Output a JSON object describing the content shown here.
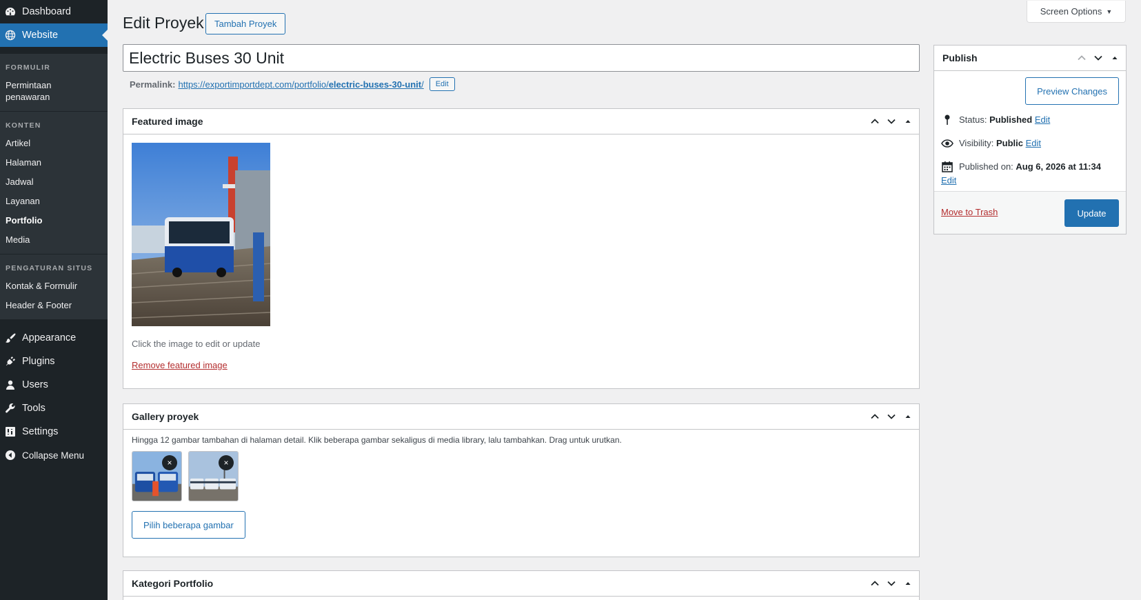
{
  "sidebar": {
    "top_items": [
      {
        "label": "Dashboard",
        "icon": "dashboard-icon"
      },
      {
        "label": "Website",
        "icon": "globe-icon",
        "active": true
      }
    ],
    "sections": [
      {
        "heading": "FORMULIR",
        "items": [
          "Permintaan penawaran"
        ]
      },
      {
        "heading": "KONTEN",
        "items": [
          "Artikel",
          "Halaman",
          "Jadwal",
          "Layanan",
          "Portfolio",
          "Media"
        ],
        "current": "Portfolio"
      },
      {
        "heading": "PENGATURAN SITUS",
        "items": [
          "Kontak & Formulir",
          "Header & Footer"
        ]
      }
    ],
    "lower_items": [
      {
        "label": "Appearance",
        "icon": "paintbrush-icon"
      },
      {
        "label": "Plugins",
        "icon": "plug-icon"
      },
      {
        "label": "Users",
        "icon": "user-icon"
      },
      {
        "label": "Tools",
        "icon": "wrench-icon"
      },
      {
        "label": "Settings",
        "icon": "settings-icon"
      },
      {
        "label": "Collapse Menu",
        "icon": "collapse-icon"
      }
    ]
  },
  "header": {
    "screen_options": "Screen Options",
    "title": "Edit Proyek",
    "add_new": "Tambah Proyek"
  },
  "post": {
    "title": "Electric Buses 30 Unit",
    "permalink_label": "Permalink:",
    "permalink_base": "https://exportimportdept.com/portfolio/",
    "permalink_slug": "electric-buses-30-unit",
    "permalink_end": "/",
    "permalink_edit": "Edit"
  },
  "featured": {
    "heading": "Featured image",
    "hint": "Click the image to edit or update",
    "remove": "Remove featured image"
  },
  "gallery": {
    "heading": "Gallery proyek",
    "description": "Hingga 12 gambar tambahan di halaman detail. Klik beberapa gambar sekaligus di media library, lalu tambahkan. Drag untuk urutkan.",
    "remove_glyph": "×",
    "button": "Pilih beberapa gambar"
  },
  "kategori": {
    "heading": "Kategori Portfolio"
  },
  "publish": {
    "heading": "Publish",
    "preview": "Preview Changes",
    "status_label": "Status:",
    "status_value": "Published",
    "visibility_label": "Visibility:",
    "visibility_value": "Public",
    "published_label": "Published on:",
    "published_value": "Aug 6, 2026 at 11:34",
    "edit": "Edit",
    "trash": "Move to Trash",
    "update": "Update"
  },
  "colors": {
    "admin_bar": "#1d2327",
    "accent": "#2271b1",
    "danger": "#b32d2e"
  }
}
